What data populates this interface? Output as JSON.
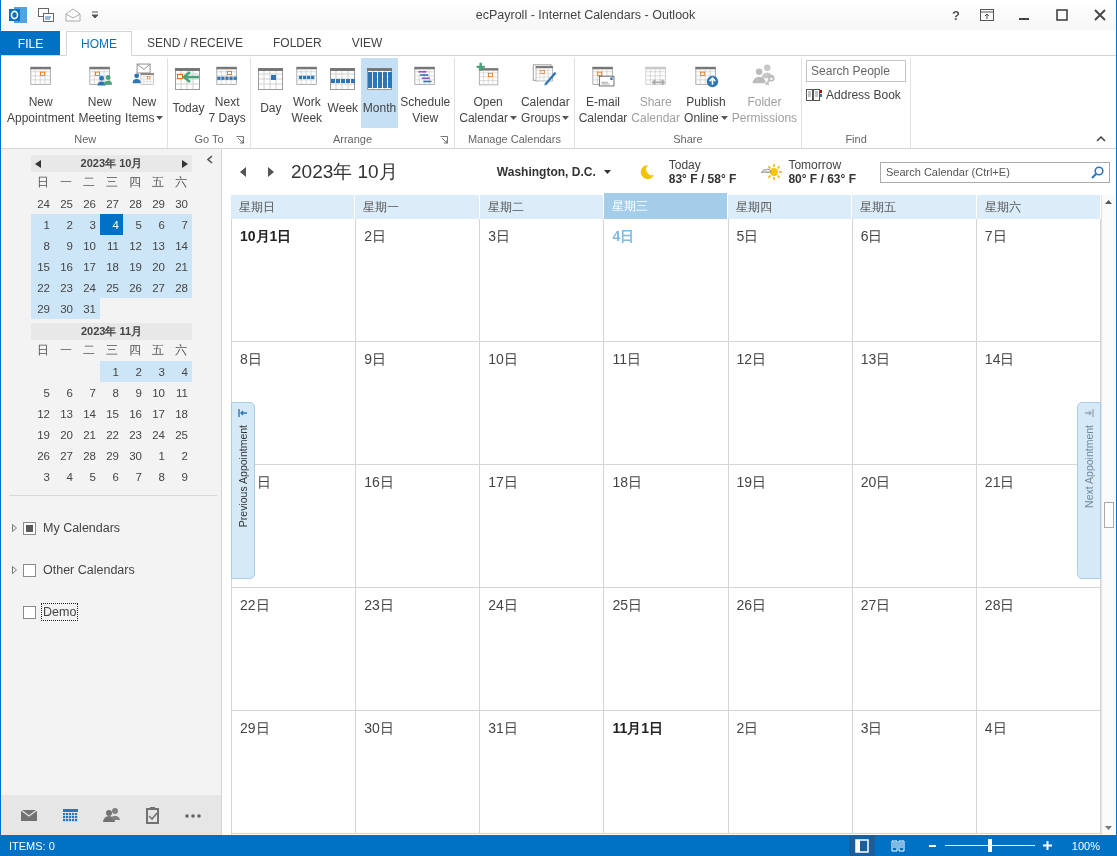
{
  "window": {
    "title": "ecPayroll - Internet Calendars - Outlook",
    "help": "?"
  },
  "tabs": [
    {
      "label": "FILE",
      "kind": "file",
      "selected": false
    },
    {
      "label": "HOME",
      "kind": "tab",
      "selected": true
    },
    {
      "label": "SEND / RECEIVE",
      "kind": "tab",
      "selected": false
    },
    {
      "label": "FOLDER",
      "kind": "tab",
      "selected": false
    },
    {
      "label": "VIEW",
      "kind": "tab",
      "selected": false
    }
  ],
  "ribbon": {
    "groups": [
      {
        "label": "New",
        "kind": "buttons",
        "launcher": false,
        "buttons": [
          {
            "lines": [
              "New",
              "Appointment"
            ],
            "kind": "appointment",
            "dropdown": false,
            "disabled": false,
            "selected": false
          },
          {
            "lines": [
              "New",
              "Meeting"
            ],
            "kind": "meeting",
            "dropdown": false,
            "disabled": false,
            "selected": false
          },
          {
            "lines": [
              "New",
              "Items"
            ],
            "kind": "items",
            "dropdown": true,
            "disabled": false,
            "selected": false
          }
        ]
      },
      {
        "label": "Go To",
        "kind": "buttons",
        "launcher": true,
        "buttons": [
          {
            "lines": [
              "Today"
            ],
            "kind": "today",
            "dropdown": false,
            "disabled": false,
            "selected": false
          },
          {
            "lines": [
              "Next",
              "7 Days"
            ],
            "kind": "next7",
            "dropdown": false,
            "disabled": false,
            "selected": false
          }
        ]
      },
      {
        "label": "Arrange",
        "kind": "buttons",
        "launcher": true,
        "buttons": [
          {
            "lines": [
              "Day"
            ],
            "kind": "day",
            "dropdown": false,
            "disabled": false,
            "selected": false
          },
          {
            "lines": [
              "Work",
              "Week"
            ],
            "kind": "workweek",
            "dropdown": false,
            "disabled": false,
            "selected": false
          },
          {
            "lines": [
              "Week"
            ],
            "kind": "week",
            "dropdown": false,
            "disabled": false,
            "selected": false
          },
          {
            "lines": [
              "Month"
            ],
            "kind": "month",
            "dropdown": false,
            "disabled": false,
            "selected": true
          },
          {
            "lines": [
              "Schedule",
              "View"
            ],
            "kind": "schedule",
            "dropdown": false,
            "disabled": false,
            "selected": false
          }
        ]
      },
      {
        "label": "Manage Calendars",
        "kind": "buttons",
        "launcher": false,
        "buttons": [
          {
            "lines": [
              "Open",
              "Calendar"
            ],
            "kind": "open",
            "dropdown": true,
            "disabled": false,
            "selected": false
          },
          {
            "lines": [
              "Calendar",
              "Groups"
            ],
            "kind": "groups",
            "dropdown": true,
            "disabled": false,
            "selected": false
          }
        ]
      },
      {
        "label": "Share",
        "kind": "buttons",
        "launcher": false,
        "buttons": [
          {
            "lines": [
              "E-mail",
              "Calendar"
            ],
            "kind": "email",
            "dropdown": false,
            "disabled": false,
            "selected": false
          },
          {
            "lines": [
              "Share",
              "Calendar"
            ],
            "kind": "share",
            "dropdown": false,
            "disabled": true,
            "selected": false
          },
          {
            "lines": [
              "Publish",
              "Online"
            ],
            "kind": "publish",
            "dropdown": true,
            "disabled": false,
            "selected": false
          },
          {
            "lines": [
              "Folder",
              "Permissions"
            ],
            "kind": "permissions",
            "dropdown": false,
            "disabled": true,
            "selected": false
          }
        ]
      },
      {
        "label": "Find",
        "kind": "find",
        "launcher": false,
        "search": {
          "placeholder": "Search People"
        },
        "address_book": "Address Book"
      }
    ]
  },
  "navigator": {
    "months": [
      {
        "title": "2023年 10月",
        "arrows": true,
        "weekdays": [
          "日",
          "一",
          "二",
          "三",
          "四",
          "五",
          "六"
        ],
        "weeks": [
          [
            {
              "label": "24",
              "kind": "day",
              "highlighted": false,
              "selected": false
            },
            {
              "label": "25",
              "kind": "day",
              "highlighted": false,
              "selected": false
            },
            {
              "label": "26",
              "kind": "day",
              "highlighted": false,
              "selected": false
            },
            {
              "label": "27",
              "kind": "day",
              "highlighted": false,
              "selected": false
            },
            {
              "label": "28",
              "kind": "day",
              "highlighted": false,
              "selected": false
            },
            {
              "label": "29",
              "kind": "day",
              "highlighted": false,
              "selected": false
            },
            {
              "label": "30",
              "kind": "day",
              "highlighted": false,
              "selected": false
            }
          ],
          [
            {
              "label": "1",
              "kind": "day",
              "highlighted": true,
              "selected": false
            },
            {
              "label": "2",
              "kind": "day",
              "highlighted": true,
              "selected": false
            },
            {
              "label": "3",
              "kind": "day",
              "highlighted": true,
              "selected": false
            },
            {
              "label": "4",
              "kind": "day",
              "highlighted": true,
              "selected": true
            },
            {
              "label": "5",
              "kind": "day",
              "highlighted": true,
              "selected": false
            },
            {
              "label": "6",
              "kind": "day",
              "highlighted": true,
              "selected": false
            },
            {
              "label": "7",
              "kind": "day",
              "highlighted": true,
              "selected": false
            }
          ],
          [
            {
              "label": "8",
              "kind": "day",
              "highlighted": true,
              "selected": false
            },
            {
              "label": "9",
              "kind": "day",
              "highlighted": true,
              "selected": false
            },
            {
              "label": "10",
              "kind": "day",
              "highlighted": true,
              "selected": false
            },
            {
              "label": "11",
              "kind": "day",
              "highlighted": true,
              "selected": false
            },
            {
              "label": "12",
              "kind": "day",
              "highlighted": true,
              "selected": false
            },
            {
              "label": "13",
              "kind": "day",
              "highlighted": true,
              "selected": false
            },
            {
              "label": "14",
              "kind": "day",
              "highlighted": true,
              "selected": false
            }
          ],
          [
            {
              "label": "15",
              "kind": "day",
              "highlighted": true,
              "selected": false
            },
            {
              "label": "16",
              "kind": "day",
              "highlighted": true,
              "selected": false
            },
            {
              "label": "17",
              "kind": "day",
              "highlighted": true,
              "selected": false
            },
            {
              "label": "18",
              "kind": "day",
              "highlighted": true,
              "selected": false
            },
            {
              "label": "19",
              "kind": "day",
              "highlighted": true,
              "selected": false
            },
            {
              "label": "20",
              "kind": "day",
              "highlighted": true,
              "selected": false
            },
            {
              "label": "21",
              "kind": "day",
              "highlighted": true,
              "selected": false
            }
          ],
          [
            {
              "label": "22",
              "kind": "day",
              "highlighted": true,
              "selected": false
            },
            {
              "label": "23",
              "kind": "day",
              "highlighted": true,
              "selected": false
            },
            {
              "label": "24",
              "kind": "day",
              "highlighted": true,
              "selected": false
            },
            {
              "label": "25",
              "kind": "day",
              "highlighted": true,
              "selected": false
            },
            {
              "label": "26",
              "kind": "day",
              "highlighted": true,
              "selected": false
            },
            {
              "label": "27",
              "kind": "day",
              "highlighted": true,
              "selected": false
            },
            {
              "label": "28",
              "kind": "day",
              "highlighted": true,
              "selected": false
            }
          ],
          [
            {
              "label": "29",
              "kind": "day",
              "highlighted": true,
              "selected": false
            },
            {
              "label": "30",
              "kind": "day",
              "highlighted": true,
              "selected": false
            },
            {
              "label": "31",
              "kind": "day",
              "highlighted": true,
              "selected": false
            }
          ]
        ]
      },
      {
        "title": "2023年 11月",
        "arrows": false,
        "weekdays": [
          "日",
          "一",
          "二",
          "三",
          "四",
          "五",
          "六"
        ],
        "weeks": [
          [
            {
              "kind": "blank"
            },
            {
              "kind": "blank"
            },
            {
              "kind": "blank"
            },
            {
              "label": "1",
              "kind": "day",
              "highlighted": true,
              "selected": false
            },
            {
              "label": "2",
              "kind": "day",
              "highlighted": true,
              "selected": false
            },
            {
              "label": "3",
              "kind": "day",
              "highlighted": true,
              "selected": false
            },
            {
              "label": "4",
              "kind": "day",
              "highlighted": true,
              "selected": false
            }
          ],
          [
            {
              "label": "5",
              "kind": "day",
              "highlighted": false,
              "selected": false
            },
            {
              "label": "6",
              "kind": "day",
              "highlighted": false,
              "selected": false
            },
            {
              "label": "7",
              "kind": "day",
              "highlighted": false,
              "selected": false
            },
            {
              "label": "8",
              "kind": "day",
              "highlighted": false,
              "selected": false
            },
            {
              "label": "9",
              "kind": "day",
              "highlighted": false,
              "selected": false
            },
            {
              "label": "10",
              "kind": "day",
              "highlighted": false,
              "selected": false
            },
            {
              "label": "11",
              "kind": "day",
              "highlighted": false,
              "selected": false
            }
          ],
          [
            {
              "label": "12",
              "kind": "day",
              "highlighted": false,
              "selected": false
            },
            {
              "label": "13",
              "kind": "day",
              "highlighted": false,
              "selected": false
            },
            {
              "label": "14",
              "kind": "day",
              "highlighted": false,
              "selected": false
            },
            {
              "label": "15",
              "kind": "day",
              "highlighted": false,
              "selected": false
            },
            {
              "label": "16",
              "kind": "day",
              "highlighted": false,
              "selected": false
            },
            {
              "label": "17",
              "kind": "day",
              "highlighted": false,
              "selected": false
            },
            {
              "label": "18",
              "kind": "day",
              "highlighted": false,
              "selected": false
            }
          ],
          [
            {
              "label": "19",
              "kind": "day",
              "highlighted": false,
              "selected": false
            },
            {
              "label": "20",
              "kind": "day",
              "highlighted": false,
              "selected": false
            },
            {
              "label": "21",
              "kind": "day",
              "highlighted": false,
              "selected": false
            },
            {
              "label": "22",
              "kind": "day",
              "highlighted": false,
              "selected": false
            },
            {
              "label": "23",
              "kind": "day",
              "highlighted": false,
              "selected": false
            },
            {
              "label": "24",
              "kind": "day",
              "highlighted": false,
              "selected": false
            },
            {
              "label": "25",
              "kind": "day",
              "highlighted": false,
              "selected": false
            }
          ],
          [
            {
              "label": "26",
              "kind": "day",
              "highlighted": false,
              "selected": false
            },
            {
              "label": "27",
              "kind": "day",
              "highlighted": false,
              "selected": false
            },
            {
              "label": "28",
              "kind": "day",
              "highlighted": false,
              "selected": false
            },
            {
              "label": "29",
              "kind": "day",
              "highlighted": false,
              "selected": false
            },
            {
              "label": "30",
              "kind": "day",
              "highlighted": false,
              "selected": false
            },
            {
              "label": "1",
              "kind": "day",
              "highlighted": false,
              "selected": false
            },
            {
              "label": "2",
              "kind": "day",
              "highlighted": false,
              "selected": false
            }
          ],
          [
            {
              "label": "3",
              "kind": "day",
              "highlighted": false,
              "selected": false
            },
            {
              "label": "4",
              "kind": "day",
              "highlighted": false,
              "selected": false
            },
            {
              "label": "5",
              "kind": "day",
              "highlighted": false,
              "selected": false
            },
            {
              "label": "6",
              "kind": "day",
              "highlighted": false,
              "selected": false
            },
            {
              "label": "7",
              "kind": "day",
              "highlighted": false,
              "selected": false
            },
            {
              "label": "8",
              "kind": "day",
              "highlighted": false,
              "selected": false
            },
            {
              "label": "9",
              "kind": "day",
              "highlighted": false,
              "selected": false
            }
          ]
        ]
      }
    ]
  },
  "folders": [
    {
      "label": "My Calendars",
      "kind": "group",
      "expanded": false,
      "checked": true,
      "focused": false
    },
    {
      "label": "Other Calendars",
      "kind": "group",
      "expanded": false,
      "checked": false,
      "focused": false
    },
    {
      "label": "Demo",
      "kind": "calendar",
      "checked": false,
      "focused": true
    }
  ],
  "nav_bar": [
    {
      "kind": "mail",
      "selected": false
    },
    {
      "kind": "calendar",
      "selected": true
    },
    {
      "kind": "people",
      "selected": false
    },
    {
      "kind": "tasks",
      "selected": false
    },
    {
      "kind": "more",
      "selected": false
    }
  ],
  "calendar": {
    "title": "2023年 10月",
    "location": "Washington,  D.C.",
    "weather": [
      {
        "kind": "moon",
        "day": "Today",
        "temps": "83° F / 58° F"
      },
      {
        "kind": "sun_cloud",
        "day": "Tomorrow",
        "temps": "80° F / 63° F"
      }
    ],
    "search": {
      "placeholder": "Search Calendar (Ctrl+E)"
    },
    "weekdays": [
      {
        "label": "星期日",
        "selected": false
      },
      {
        "label": "星期一",
        "selected": false
      },
      {
        "label": "星期二",
        "selected": false
      },
      {
        "label": "星期三",
        "selected": true
      },
      {
        "label": "星期四",
        "selected": false
      },
      {
        "label": "星期五",
        "selected": false
      },
      {
        "label": "星期六",
        "selected": false
      }
    ],
    "weeks": [
      [
        {
          "label": "10月1日",
          "kind": "month_start"
        },
        {
          "label": "2日",
          "kind": "day"
        },
        {
          "label": "3日",
          "kind": "day"
        },
        {
          "label": "4日",
          "kind": "today"
        },
        {
          "label": "5日",
          "kind": "day"
        },
        {
          "label": "6日",
          "kind": "day"
        },
        {
          "label": "7日",
          "kind": "day"
        }
      ],
      [
        {
          "label": "8日",
          "kind": "day"
        },
        {
          "label": "9日",
          "kind": "day"
        },
        {
          "label": "10日",
          "kind": "day"
        },
        {
          "label": "11日",
          "kind": "day"
        },
        {
          "label": "12日",
          "kind": "day"
        },
        {
          "label": "13日",
          "kind": "day"
        },
        {
          "label": "14日",
          "kind": "day"
        }
      ],
      [
        {
          "label": "日",
          "kind": "partial"
        },
        {
          "label": "16日",
          "kind": "day"
        },
        {
          "label": "17日",
          "kind": "day"
        },
        {
          "label": "18日",
          "kind": "day"
        },
        {
          "label": "19日",
          "kind": "day"
        },
        {
          "label": "20日",
          "kind": "day"
        },
        {
          "label": "21日",
          "kind": "day"
        }
      ],
      [
        {
          "label": "22日",
          "kind": "day"
        },
        {
          "label": "23日",
          "kind": "day"
        },
        {
          "label": "24日",
          "kind": "day"
        },
        {
          "label": "25日",
          "kind": "day"
        },
        {
          "label": "26日",
          "kind": "day"
        },
        {
          "label": "27日",
          "kind": "day"
        },
        {
          "label": "28日",
          "kind": "day"
        }
      ],
      [
        {
          "label": "29日",
          "kind": "day"
        },
        {
          "label": "30日",
          "kind": "day"
        },
        {
          "label": "31日",
          "kind": "day"
        },
        {
          "label": "11月1日",
          "kind": "month_start"
        },
        {
          "label": "2日",
          "kind": "day"
        },
        {
          "label": "3日",
          "kind": "day"
        },
        {
          "label": "4日",
          "kind": "day"
        }
      ]
    ],
    "prev_tab": "Previous Appointment",
    "next_tab": "Next Appointment"
  },
  "status_bar": {
    "items": "ITEMS: 0",
    "views": [
      {
        "kind": "normal",
        "selected": true
      },
      {
        "kind": "reading",
        "selected": false
      }
    ],
    "zoom": {
      "level": 0.5,
      "label": "100%"
    }
  }
}
